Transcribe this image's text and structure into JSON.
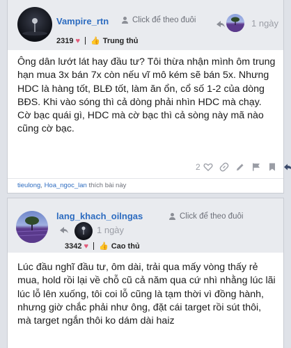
{
  "posts": [
    {
      "username": "Vampire_rtn",
      "follow_label": "Click để theo đuôi",
      "time": "1 ngày",
      "score": "2319",
      "rank": "Trung thủ",
      "content": "Ông dân lướt lát hay đầu tư? Tôi thừa nhận mình ôm trung hạn mua 3x bán 7x còn nếu vĩ mô kém sẽ bán 5x. Nhưng HDC là hàng tốt, BLĐ tốt, làm ăn ổn, cổ số 1-2 của dòng BĐS. Khi vào sóng thì cả dòng phải nhìn HDC mà chạy. Cờ bạc quái gì, HDC mà cờ bạc thì cả sòng này mã nào cũng cờ bạc.",
      "like_count": "2",
      "likers": [
        "tieulong",
        "Hoa_ngoc_lan"
      ],
      "liked_suffix": "thích bài này"
    },
    {
      "username": "lang_khach_oilngas",
      "follow_label": "Click để theo đuôi",
      "time": "1 ngày",
      "score": "3342",
      "rank": "Cao thủ",
      "content": "Lúc đầu nghĩ đầu tư, ôm dài, trải qua mấy vòng thấy rẻ mua, hold rồi lại về chỗ cũ cả năm qua cứ nhì nhằng lúc lãi lúc lỗ lên xuống, tôi coi lỗ cũng là tạm thời vì đồng hành, nhưng giờ chắc phải như ông, đặt cái target rồi sút thôi, mà target ngắn thôi ko dám dài haiz"
    }
  ],
  "icons": {
    "follow": "user-icon",
    "reply_to": "reply-arrow-icon",
    "heart": "heart-icon",
    "rank": "thumbs-up-icon",
    "like": "heart-outline-icon",
    "link": "link-icon",
    "edit": "pencil-icon",
    "flag": "flag-icon",
    "bookmark": "bookmark-icon",
    "reply": "reply-icon"
  },
  "colors": {
    "link": "#2d6cc0",
    "heart": "#e25a7a",
    "header_bg": "#e9ebef"
  }
}
